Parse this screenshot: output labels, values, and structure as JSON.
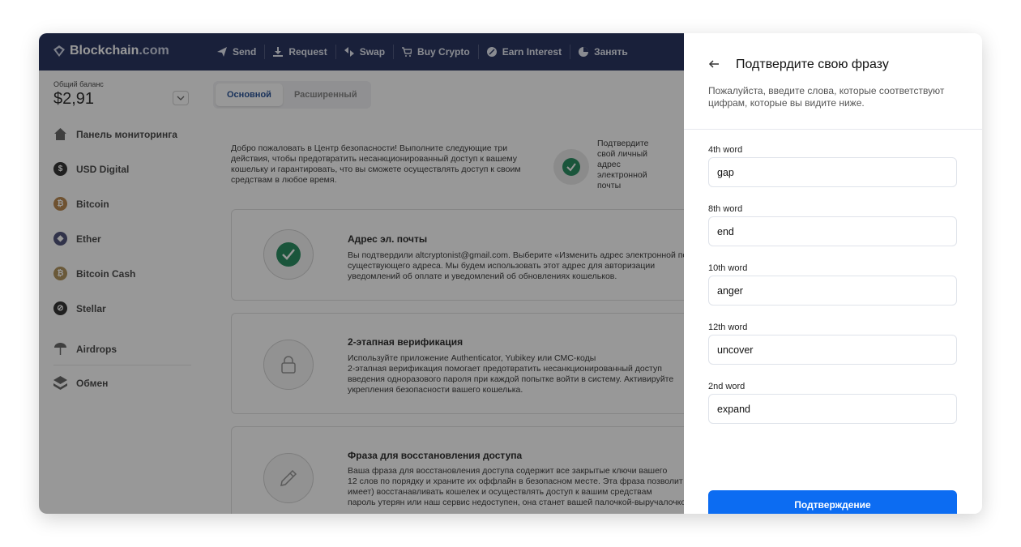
{
  "app": {
    "logo_main": "Blockchain",
    "logo_suffix": ".com",
    "nav": [
      "Send",
      "Request",
      "Swap",
      "Buy Crypto",
      "Earn Interest",
      "Занять"
    ]
  },
  "sidebar": {
    "balance_label": "Общий баланс",
    "balance_value": "$2,91",
    "items": [
      {
        "label": "Панель мониторинга",
        "icon": "home-icon"
      },
      {
        "label": "USD Digital",
        "icon": "usd-icon"
      },
      {
        "label": "Bitcoin",
        "icon": "bitcoin-icon"
      },
      {
        "label": "Ether",
        "icon": "ether-icon"
      },
      {
        "label": "Bitcoin Cash",
        "icon": "bitcoin-cash-icon"
      },
      {
        "label": "Stellar",
        "icon": "stellar-icon"
      },
      {
        "label": "Airdrops",
        "icon": "airdrops-icon"
      },
      {
        "label": "Обмен",
        "icon": "exchange-icon"
      }
    ]
  },
  "content": {
    "tabs": [
      "Основной",
      "Расширенный"
    ],
    "welcome": "Добро пожаловать в Центр безопасности! Выполните следующие три действия, чтобы предотвратить несанкционированный доступ к вашему кошельку и гарантировать, что вы сможете осуществлять доступ к своим средствам в любое время.",
    "confirm_email_note": "Подтвердите свой личный адрес электронной почты",
    "cards": [
      {
        "title": "Адрес эл. почты",
        "lines": [
          "Вы подтвердили altcryptonist@gmail.com. Выберите «Изменить адрес электронной почты»",
          "существующего адреса. Мы будем использовать этот адрес для авторизации",
          "уведомлений об оплате и уведомлений об обновлениях кошельков."
        ]
      },
      {
        "title": "2-этапная верификация",
        "lines": [
          "Используйте приложение Authenticator, Yubikey или СМС-коды",
          "2-этапная верификация помогает предотвратить несанкционированный доступ",
          "введения одноразового пароля при каждой попытке войти в систему. Активируйте",
          "укрепления безопасности вашего кошелька."
        ]
      },
      {
        "title": "Фраза для восстановления доступа",
        "lines": [
          "Ваша фраза для восстановления доступа содержит все закрытые ключи вашего",
          "12 слов по порядку и храните их оффлайн в безопасном месте. Эта фраза позволит",
          "имеет) восстанавливать кошелек и осуществлять доступ к вашим средствам",
          "пароль утерян или наш сервис недоступен, она станет вашей палочкой-выручалочкой"
        ]
      }
    ]
  },
  "panel": {
    "title": "Подтвердите свою фразу",
    "subtitle": "Пожалуйста, введите слова, которые соответствуют цифрам, которые вы видите ниже.",
    "fields": [
      {
        "label": "4th word",
        "value": "gap"
      },
      {
        "label": "8th word",
        "value": "end"
      },
      {
        "label": "10th word",
        "value": "anger"
      },
      {
        "label": "12th word",
        "value": "uncover"
      },
      {
        "label": "2nd word",
        "value": "expand"
      }
    ],
    "submit_label": "Подтверждение"
  },
  "colors": {
    "topbar": "#0c1a4b",
    "accent": "#0c6cf2",
    "check": "#0e7f4e"
  }
}
